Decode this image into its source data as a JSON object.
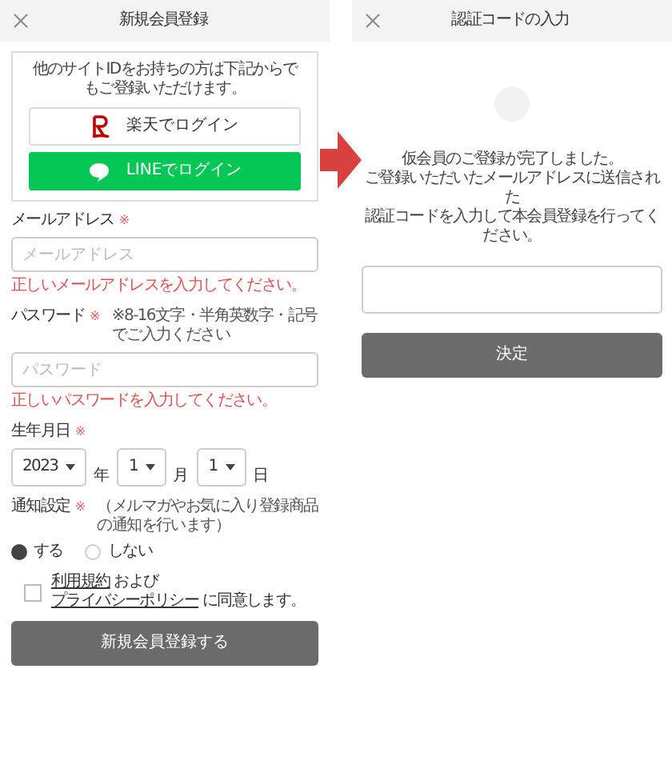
{
  "signup": {
    "title": "新規会員登録",
    "social_login": {
      "note": "他のサイトIDをお持ちの方は下記からでもご登録いただけます。",
      "buttons": [
        {
          "kind": "rakuten",
          "label": "楽天でログイン"
        },
        {
          "kind": "line",
          "label": "LINEでログイン"
        }
      ]
    },
    "email": {
      "label": "メールアドレス",
      "required_mark": "※",
      "placeholder": "メールアドレス",
      "error": "正しいメールアドレスを入力してください。"
    },
    "password": {
      "label": "パスワード",
      "required_mark": "※",
      "hint": "※8-16文字・半角英数字・記号でご入力ください",
      "placeholder": "パスワード",
      "error": "正しいパスワードを入力してください。"
    },
    "birthday": {
      "label": "生年月日",
      "required_mark": "※",
      "selects": [
        {
          "value": "2023",
          "unit": "年"
        },
        {
          "value": "1",
          "unit": "月"
        },
        {
          "value": "1",
          "unit": "日"
        }
      ]
    },
    "notification": {
      "label": "通知設定",
      "required_mark": "※",
      "hint": "（メルマガやお気に入り登録商品の通知を行います）",
      "options": [
        {
          "label": "する",
          "selected": true
        },
        {
          "label": "しない",
          "selected": false
        }
      ]
    },
    "agreement": {
      "checked": false,
      "parts": [
        {
          "kind": "link",
          "text": "利用規約"
        },
        {
          "kind": "text",
          "text": " および "
        },
        {
          "kind": "link",
          "text": "プライバシーポリシー"
        },
        {
          "kind": "text",
          "text": " に同意します。"
        }
      ]
    },
    "submit_button": "新規会員登録する"
  },
  "verification": {
    "title": "認証コードの入力",
    "message_lines": [
      "仮会員のご登録が完了しました。",
      "ご登録いただいたメールアドレスに送信された",
      "認証コードを入力して本会員登録を行ってください。"
    ],
    "submit_button": "決定"
  }
}
